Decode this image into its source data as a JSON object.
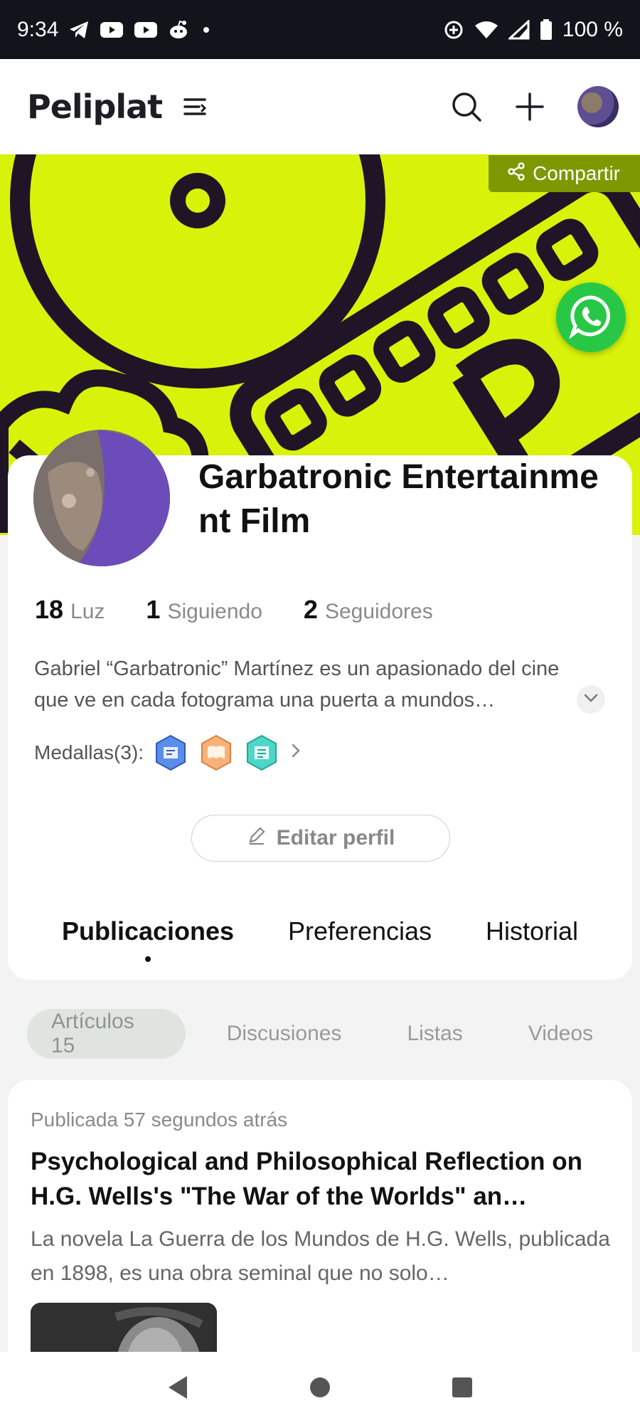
{
  "status_bar": {
    "time": "9:34",
    "battery": "100 %",
    "left_icons": [
      "telegram-icon",
      "youtube-icon",
      "youtube-icon",
      "reddit-icon",
      "dot-icon"
    ],
    "right_icons": [
      "data-saver-icon",
      "wifi-icon",
      "signal-icon",
      "battery-icon"
    ]
  },
  "header": {
    "logo": "Peliplat",
    "icons": [
      "menu-icon",
      "search-icon",
      "plus-icon",
      "avatar"
    ]
  },
  "banner": {
    "share_label": "Compartir",
    "accent": "#d8f20a"
  },
  "profile": {
    "name": "Garbatronic Entertainment Film",
    "stats": [
      {
        "value": "18",
        "label": "Luz"
      },
      {
        "value": "1",
        "label": "Siguiendo"
      },
      {
        "value": "2",
        "label": "Seguidores"
      }
    ],
    "bio": "Gabriel “Garbatronic” Martínez es un apasionado del cine que ve en cada fotograma una puerta a mundos…",
    "medals_label": "Medallas(3):",
    "edit_label": "Editar perfil"
  },
  "tabs": [
    {
      "label": "Publicaciones",
      "active": true
    },
    {
      "label": "Preferencias",
      "active": false
    },
    {
      "label": "Historial",
      "active": false
    }
  ],
  "subtabs": [
    {
      "label": "Artículos 15",
      "active": true
    },
    {
      "label": "Discusiones",
      "active": false
    },
    {
      "label": "Listas",
      "active": false
    },
    {
      "label": "Videos",
      "active": false
    }
  ],
  "post": {
    "meta": "Publicada 57 segundos atrás",
    "title": "Psychological and Philosophical Reflection on H.G. Wells's \"The War of the Worlds\" an…",
    "excerpt": "La novela La Guerra de los Mundos de H.G. Wells, publicada en 1898, es una obra seminal que no solo…"
  }
}
